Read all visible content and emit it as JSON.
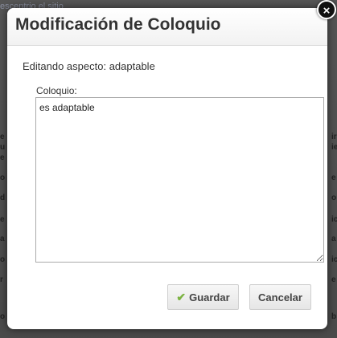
{
  "background": {
    "top_text": "escentrio el sitio",
    "fragments": [
      "e",
      "u",
      "e",
      "o",
      "d",
      "e",
      "a",
      "o",
      "r",
      "o",
      "ir",
      "ie",
      "e",
      "o",
      "ic",
      "a",
      "ic",
      "e",
      "b"
    ]
  },
  "dialog": {
    "title": "Modificación de Coloquio",
    "close_label": "×",
    "editing_label": "Editando aspecto: adaptable",
    "field_label": "Coloquio:",
    "field_value": "es adaptable",
    "save_label": "Guardar",
    "cancel_label": "Cancelar",
    "save_icon": "check-icon"
  },
  "colors": {
    "overlay": "#4a4a4a",
    "dialog_bg": "#ffffff",
    "check_icon": "#7cb342"
  }
}
